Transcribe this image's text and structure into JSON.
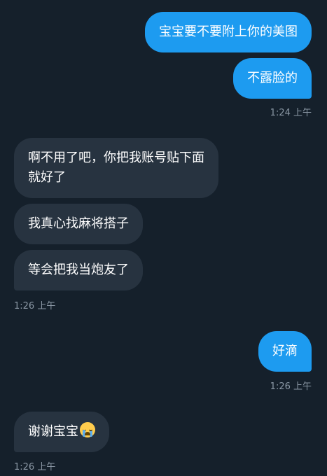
{
  "messages": [
    {
      "text": "宝宝要不要附上你的美图"
    },
    {
      "text": "不露脸的"
    },
    {
      "time": "1:24 上午"
    },
    {
      "text_line1": "啊不用了吧，你把我账号贴下面",
      "text_line2": "就好了"
    },
    {
      "text": "我真心找麻将搭子"
    },
    {
      "text": "等会把我当炮友了"
    },
    {
      "time": "1:26 上午"
    },
    {
      "text": "好滴"
    },
    {
      "time": "1:26 上午"
    },
    {
      "text": "谢谢宝宝",
      "emoji": "loudly-crying-face"
    },
    {
      "time": "1:26 上午"
    }
  ],
  "colors": {
    "background": "#15202b",
    "outgoing_bubble": "#1d9bf0",
    "incoming_bubble": "#273340",
    "timestamp": "#8b98a5"
  }
}
